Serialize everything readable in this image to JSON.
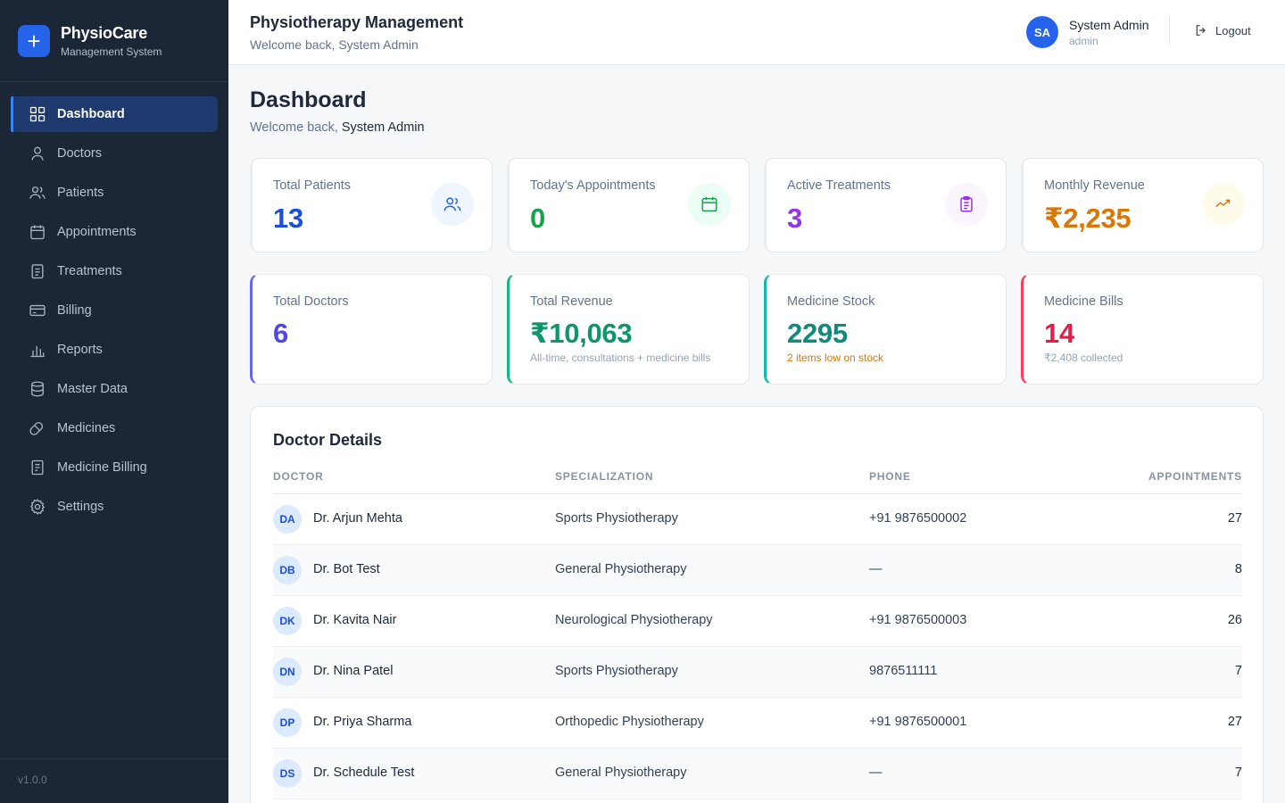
{
  "brand": {
    "name": "PhysioCare",
    "subtitle": "Management System",
    "logo_icon": "plus-icon"
  },
  "sidebar": {
    "items": [
      {
        "label": "Dashboard",
        "icon": "grid-icon",
        "active": true
      },
      {
        "label": "Doctors",
        "icon": "user-icon"
      },
      {
        "label": "Patients",
        "icon": "users-icon"
      },
      {
        "label": "Appointments",
        "icon": "calendar-icon"
      },
      {
        "label": "Treatments",
        "icon": "clipboard-icon"
      },
      {
        "label": "Billing",
        "icon": "credit-card-icon"
      },
      {
        "label": "Reports",
        "icon": "bar-chart-icon"
      },
      {
        "label": "Master Data",
        "icon": "database-icon"
      },
      {
        "label": "Medicines",
        "icon": "pill-icon"
      },
      {
        "label": "Medicine Billing",
        "icon": "receipt-icon"
      },
      {
        "label": "Settings",
        "icon": "gear-icon"
      }
    ],
    "version": "v1.0.0"
  },
  "header": {
    "title": "Physiotherapy Management",
    "subtitle": "Welcome back, System Admin",
    "user": {
      "initials": "SA",
      "name": "System Admin",
      "role": "admin"
    },
    "logout_label": "Logout"
  },
  "page": {
    "title": "Dashboard",
    "subtitle_prefix": "Welcome back, ",
    "subtitle_name": "System Admin"
  },
  "stats_row1": [
    {
      "label": "Total Patients",
      "value": "13",
      "color": "#1d4ed8",
      "icon": "users-icon",
      "icon_bg": "#eff6ff"
    },
    {
      "label": "Today's Appointments",
      "value": "0",
      "color": "#16a34a",
      "icon": "calendar-icon",
      "icon_bg": "#ecfdf5"
    },
    {
      "label": "Active Treatments",
      "value": "3",
      "color": "#9333ea",
      "icon": "clipboard-icon",
      "icon_bg": "#faf5ff"
    },
    {
      "label": "Monthly Revenue",
      "value": "₹2,235",
      "color": "#d97706",
      "icon": "trend-icon",
      "icon_bg": "#fffbeb"
    }
  ],
  "stats_row2": [
    {
      "label": "Total Doctors",
      "value": "6",
      "note": "",
      "color": "#4f46e5",
      "accent": "#6366f1",
      "note_color": "#94a3b8"
    },
    {
      "label": "Total Revenue",
      "value": "₹10,063",
      "note": "All-time, consultations + medicine bills",
      "color": "#0d9668",
      "accent": "#10b981",
      "note_color": "#94a3b8"
    },
    {
      "label": "Medicine Stock",
      "value": "2295",
      "note": "2 items low on stock",
      "color": "#0f8a7d",
      "accent": "#14b8a6",
      "note_color": "#d97706"
    },
    {
      "label": "Medicine Bills",
      "value": "14",
      "note": "₹2,408 collected",
      "color": "#e11d48",
      "accent": "#f43f5e",
      "note_color": "#94a3b8"
    }
  ],
  "doctor_table": {
    "title": "Doctor Details",
    "columns": [
      "DOCTOR",
      "SPECIALIZATION",
      "PHONE",
      "APPOINTMENTS"
    ],
    "rows": [
      {
        "initials": "DA",
        "name": "Dr. Arjun Mehta",
        "specialization": "Sports Physiotherapy",
        "phone": "+91 9876500002",
        "appointments": "27"
      },
      {
        "initials": "DB",
        "name": "Dr. Bot Test",
        "specialization": "General Physiotherapy",
        "phone": "—",
        "appointments": "8"
      },
      {
        "initials": "DK",
        "name": "Dr. Kavita Nair",
        "specialization": "Neurological Physiotherapy",
        "phone": "+91 9876500003",
        "appointments": "26"
      },
      {
        "initials": "DN",
        "name": "Dr. Nina Patel",
        "specialization": "Sports Physiotherapy",
        "phone": "9876511111",
        "appointments": "7"
      },
      {
        "initials": "DP",
        "name": "Dr. Priya Sharma",
        "specialization": "Orthopedic Physiotherapy",
        "phone": "+91 9876500001",
        "appointments": "27"
      },
      {
        "initials": "DS",
        "name": "Dr. Schedule Test",
        "specialization": "General Physiotherapy",
        "phone": "—",
        "appointments": "7"
      }
    ]
  }
}
